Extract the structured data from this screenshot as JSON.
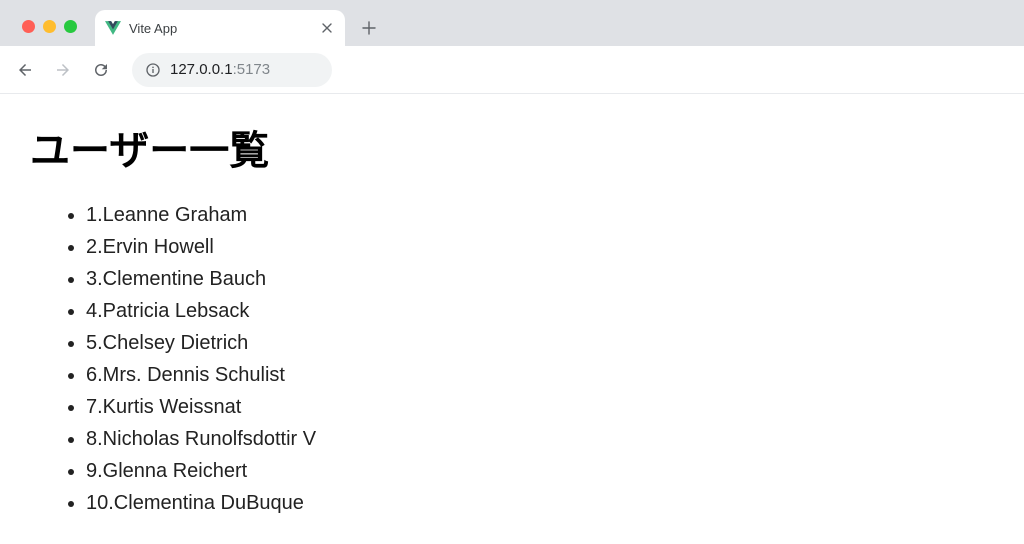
{
  "browser": {
    "tab_title": "Vite App",
    "url_host": "127.0.0.1",
    "url_port": ":5173"
  },
  "page": {
    "title": "ユーザー一覧",
    "users": [
      {
        "id": 1,
        "name": "Leanne Graham"
      },
      {
        "id": 2,
        "name": "Ervin Howell"
      },
      {
        "id": 3,
        "name": "Clementine Bauch"
      },
      {
        "id": 4,
        "name": "Patricia Lebsack"
      },
      {
        "id": 5,
        "name": "Chelsey Dietrich"
      },
      {
        "id": 6,
        "name": "Mrs. Dennis Schulist"
      },
      {
        "id": 7,
        "name": "Kurtis Weissnat"
      },
      {
        "id": 8,
        "name": "Nicholas Runolfsdottir V"
      },
      {
        "id": 9,
        "name": "Glenna Reichert"
      },
      {
        "id": 10,
        "name": "Clementina DuBuque"
      }
    ]
  }
}
